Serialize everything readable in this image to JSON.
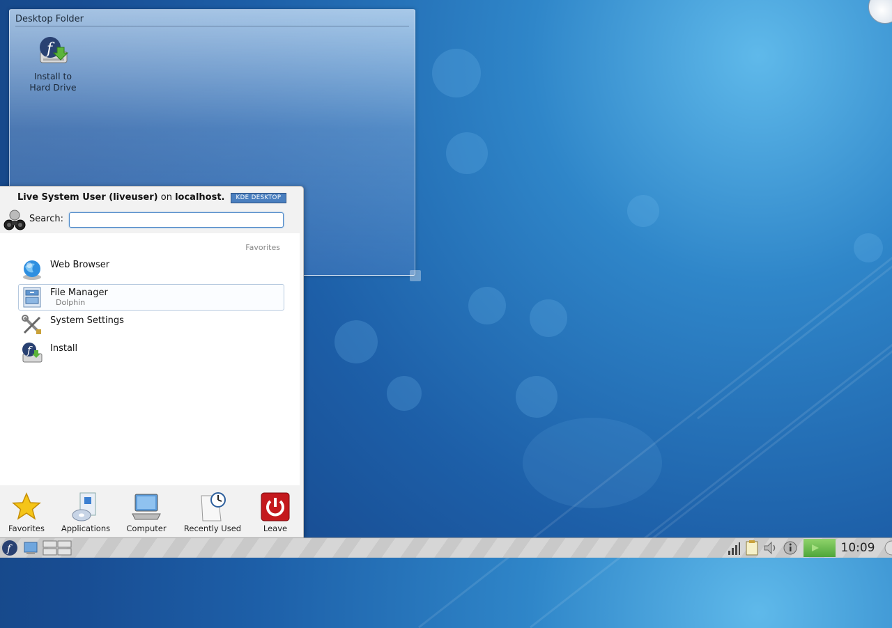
{
  "desktop": {
    "folder_title": "Desktop Folder",
    "icons": [
      {
        "label_line1": "Install to",
        "label_line2": "Hard Drive",
        "icon": "fedora-install-icon"
      }
    ]
  },
  "kickoff": {
    "user_name": "Live System User (liveuser)",
    "on_text": "on",
    "host": "localhost.",
    "badge": "KDE DESKTOP",
    "search_label": "Search:",
    "search_value": "",
    "section_header": "Favorites",
    "favorites": [
      {
        "name": "Web Browser",
        "subtitle": "",
        "icon": "globe-icon"
      },
      {
        "name": "File Manager",
        "subtitle": "Dolphin",
        "icon": "file-manager-icon"
      },
      {
        "name": "System Settings",
        "subtitle": "",
        "icon": "settings-tools-icon"
      },
      {
        "name": "Install",
        "subtitle": "",
        "icon": "fedora-install-icon"
      }
    ],
    "tabs": [
      {
        "label": "Favorites",
        "icon": "star-icon"
      },
      {
        "label": "Applications",
        "icon": "applications-icon"
      },
      {
        "label": "Computer",
        "icon": "laptop-icon"
      },
      {
        "label": "Recently Used",
        "icon": "clock-document-icon"
      },
      {
        "label": "Leave",
        "icon": "power-icon"
      }
    ]
  },
  "taskbar": {
    "clock": "10:09",
    "colors": {
      "accent": "#4a87c8",
      "leave_red": "#c4191e",
      "task_green": "#5fb544"
    }
  }
}
